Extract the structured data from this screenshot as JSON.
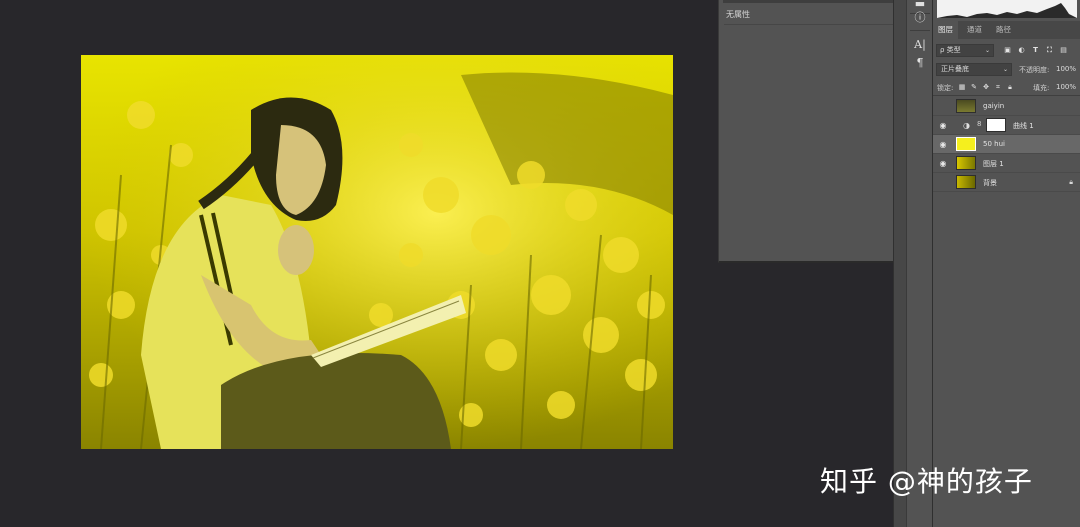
{
  "properties": {
    "title": "无属性"
  },
  "layers_panel": {
    "tabs": [
      {
        "label": "图层"
      },
      {
        "label": "通道"
      },
      {
        "label": "路径"
      }
    ],
    "filter": {
      "kind_label": "ρ 类型",
      "chevron": "⌄"
    },
    "blend": {
      "mode": "正片叠底",
      "opacity_label": "不透明度:",
      "opacity_value": "100%"
    },
    "lock": {
      "label": "锁定:",
      "fill_label": "填充:",
      "fill_value": "100%"
    },
    "layers": [
      {
        "name": "gaiyin",
        "visible": false,
        "selected": false
      },
      {
        "name": "曲线 1",
        "visible": true,
        "selected": false
      },
      {
        "name": "50 hui",
        "visible": true,
        "selected": true
      },
      {
        "name": "图层 1",
        "visible": true,
        "selected": false
      },
      {
        "name": "背景",
        "visible": false,
        "selected": false,
        "locked": true
      }
    ]
  },
  "tools": {
    "info_glyph": "ⓘ",
    "char_glyph": "A|",
    "para_glyph": "¶"
  },
  "watermark": {
    "text": "知乎 @神的孩子"
  },
  "colors": {
    "fill_layer": "#f5ef1e",
    "canvas_background": "#28272b",
    "panel": "#535353"
  }
}
